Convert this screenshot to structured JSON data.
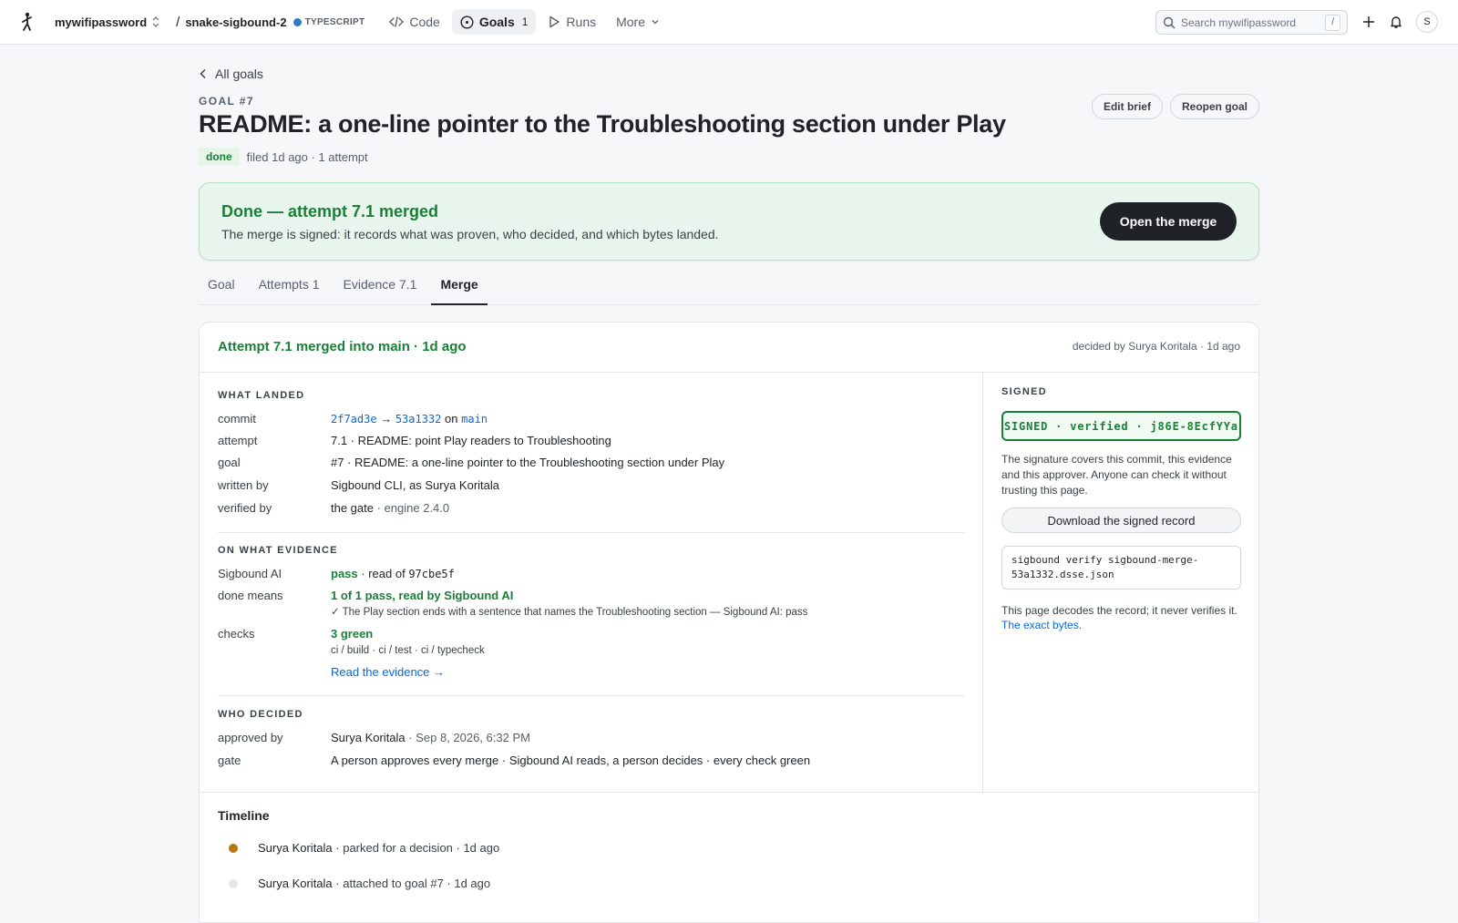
{
  "topbar": {
    "owner": "mywifipassword",
    "repo": "snake-sigbound-2",
    "language": "TYPESCRIPT",
    "nav": [
      {
        "label": "Code"
      },
      {
        "label": "Goals",
        "count": "1"
      },
      {
        "label": "Runs"
      },
      {
        "label": "More"
      }
    ],
    "search_placeholder": "Search mywifipassword",
    "search_shortcut": "/",
    "avatar_initial": "S"
  },
  "header": {
    "back_label": "All goals",
    "kicker": "GOAL #7",
    "title": "README: a one-line pointer to the Troubleshooting section under Play",
    "status": "done",
    "meta": "filed 1d ago · 1 attempt",
    "edit_label": "Edit brief",
    "reopen_label": "Reopen goal"
  },
  "banner": {
    "title": "Done — attempt 7.1 merged",
    "subtitle": "The merge is signed: it records what was proven, who decided, and which bytes landed.",
    "button": "Open the merge"
  },
  "tabs": [
    "Goal",
    "Attempts 1",
    "Evidence 7.1",
    "Merge"
  ],
  "card": {
    "title": "Attempt 7.1 merged into main · 1d ago",
    "decided": "decided by Surya Koritala · 1d ago",
    "what_landed": {
      "heading": "WHAT LANDED",
      "commit_label": "commit",
      "commit_from": "2f7ad3e",
      "arrow": "→",
      "commit_to": "53a1332",
      "on": "on",
      "branch": "main",
      "attempt_label": "attempt",
      "attempt_value": "7.1 · README: point Play readers to Troubleshooting",
      "goal_label": "goal",
      "goal_value": "#7 · README: a one-line pointer to the Troubleshooting section under Play",
      "written_label": "written by",
      "written_value": "Sigbound CLI, as Surya Koritala",
      "verified_label": "verified by",
      "verified_value": "the gate",
      "verified_engine": "· engine 2.4.0"
    },
    "evidence": {
      "heading": "ON WHAT EVIDENCE",
      "ai_label": "Sigbound AI",
      "ai_status": "pass",
      "ai_read": "· read of",
      "ai_hash": "97cbe5f",
      "done_label": "done means",
      "done_value": "1 of 1 pass, read by Sigbound AI",
      "done_detail": "✓ The Play section ends with a sentence that names the Troubleshooting section — Sigbound AI: pass",
      "checks_label": "checks",
      "checks_value": "3 green",
      "checks_detail": "ci / build · ci / test · ci / typecheck",
      "read_link": "Read the evidence →"
    },
    "decided_section": {
      "heading": "WHO DECIDED",
      "approved_label": "approved by",
      "approved_name": "Surya Koritala",
      "approved_date": "· Sep 8, 2026, 6:32 PM",
      "gate_label": "gate",
      "gate_value": "A person approves every merge · Sigbound AI reads, a person decides · every check green"
    },
    "signed": {
      "heading": "SIGNED",
      "stamp": "SIGNED · verified · j86E-8EcfYYa",
      "description": "The signature covers this commit, this evidence and this approver. Anyone can check it without trusting this page.",
      "download": "Download the signed record",
      "command": "sigbound verify sigbound-merge-53a1332.dsse.json",
      "note": "This page decodes the record; it never verifies it.",
      "note_link": "The exact bytes."
    },
    "timeline": {
      "title": "Timeline",
      "items": [
        {
          "name": "Surya Koritala",
          "text": "· parked for a decision · 1d ago",
          "color": "#b8770b"
        },
        {
          "name": "Surya Koritala",
          "text": "· attached to goal #7 · 1d ago",
          "color": "#e3e5e8"
        }
      ]
    }
  },
  "colors": {
    "accent_green": "#1a7f37",
    "link_blue": "#0969da",
    "lang_dot": "#3178c6"
  }
}
